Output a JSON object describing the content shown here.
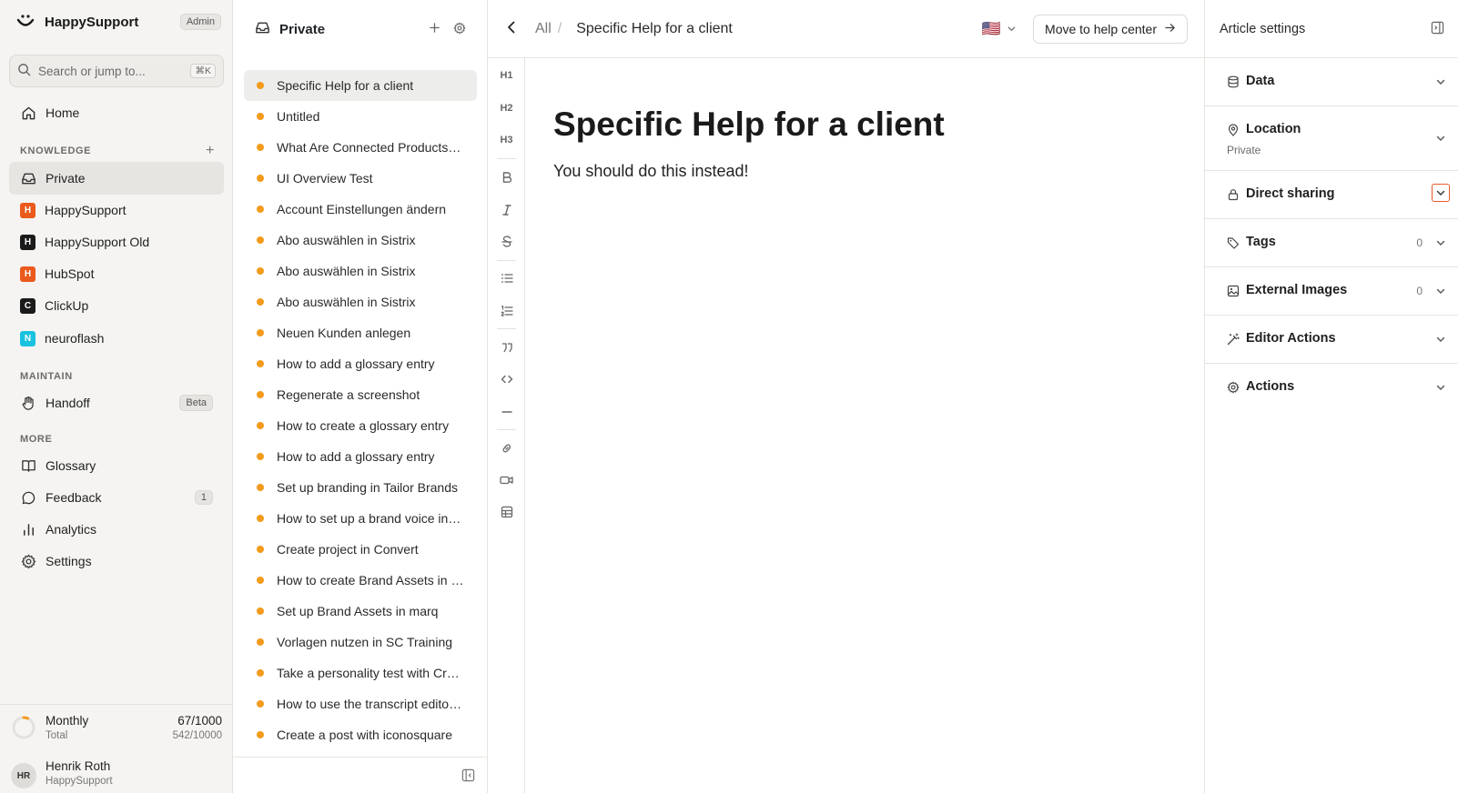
{
  "app": {
    "name": "HappySupport",
    "role_badge": "Admin",
    "search_placeholder": "Search or jump to...",
    "search_shortcut": "⌘K"
  },
  "sidebar": {
    "home_label": "Home",
    "knowledge_section": "KNOWLEDGE",
    "knowledge_items": [
      {
        "label": "Private",
        "icon": "inbox-icon",
        "active": true
      },
      {
        "label": "HappySupport",
        "initial": "H",
        "color": "#ea5a1c"
      },
      {
        "label": "HappySupport Old",
        "initial": "H",
        "color": "#1a1a1a"
      },
      {
        "label": "HubSpot",
        "initial": "H",
        "color": "#ea5a1c"
      },
      {
        "label": "ClickUp",
        "initial": "C",
        "color": "#1a1a1a"
      },
      {
        "label": "neuroflash",
        "initial": "N",
        "color": "#19c2e0"
      }
    ],
    "maintain_section": "MAINTAIN",
    "handoff_label": "Handoff",
    "handoff_badge": "Beta",
    "more_section": "MORE",
    "glossary_label": "Glossary",
    "feedback_label": "Feedback",
    "feedback_count": "1",
    "analytics_label": "Analytics",
    "settings_label": "Settings",
    "usage": {
      "monthly_label": "Monthly",
      "monthly_value": "67/1000",
      "total_label": "Total",
      "total_value": "542/10000",
      "monthly_fraction": 0.067
    },
    "user": {
      "initials": "HR",
      "name": "Henrik Roth",
      "org": "HappySupport"
    }
  },
  "article_list": {
    "title": "Private",
    "dot_color": "#f29b1d",
    "items": [
      "Specific Help for a client",
      "Untitled",
      "What Are Connected Products in Blue Yonder",
      "UI Overview Test",
      "Account Einstellungen ändern",
      "Abo auswählen in Sistrix",
      "Abo auswählen in Sistrix",
      "Abo auswählen in Sistrix",
      "Neuen Kunden anlegen",
      "How to add a glossary entry",
      "Regenerate a screenshot",
      "How to create a glossary entry",
      "How to add a glossary entry",
      "Set up branding in Tailor Brands",
      "How to set up a brand voice in neuroflash",
      "Create project in Convert",
      "How to create Brand Assets in marq",
      "Set up Brand Assets in marq",
      "Vorlagen nutzen in SC Training",
      "Take a personality test with Crystal",
      "How to use the transcript editor in Descript",
      "Create a post with iconosquare"
    ]
  },
  "topbar": {
    "crumb_all": "All",
    "crumb_sep": "/",
    "crumb_current": "Specific Help for a client",
    "language_flag": "🇺🇸",
    "move_button": "Move to help center"
  },
  "format_toolbar": {
    "h1": "H1",
    "h2": "H2",
    "h3": "H3"
  },
  "document": {
    "title": "Specific Help for a client",
    "body": "You should do this instead!"
  },
  "settings_panel": {
    "title": "Article settings",
    "sections": {
      "data": "Data",
      "location": "Location",
      "location_value": "Private",
      "direct_sharing": "Direct sharing",
      "tags": "Tags",
      "tags_count": "0",
      "external_images": "External Images",
      "external_images_count": "0",
      "editor_actions": "Editor Actions",
      "actions": "Actions"
    },
    "accent_color": "#ea5a2c"
  }
}
